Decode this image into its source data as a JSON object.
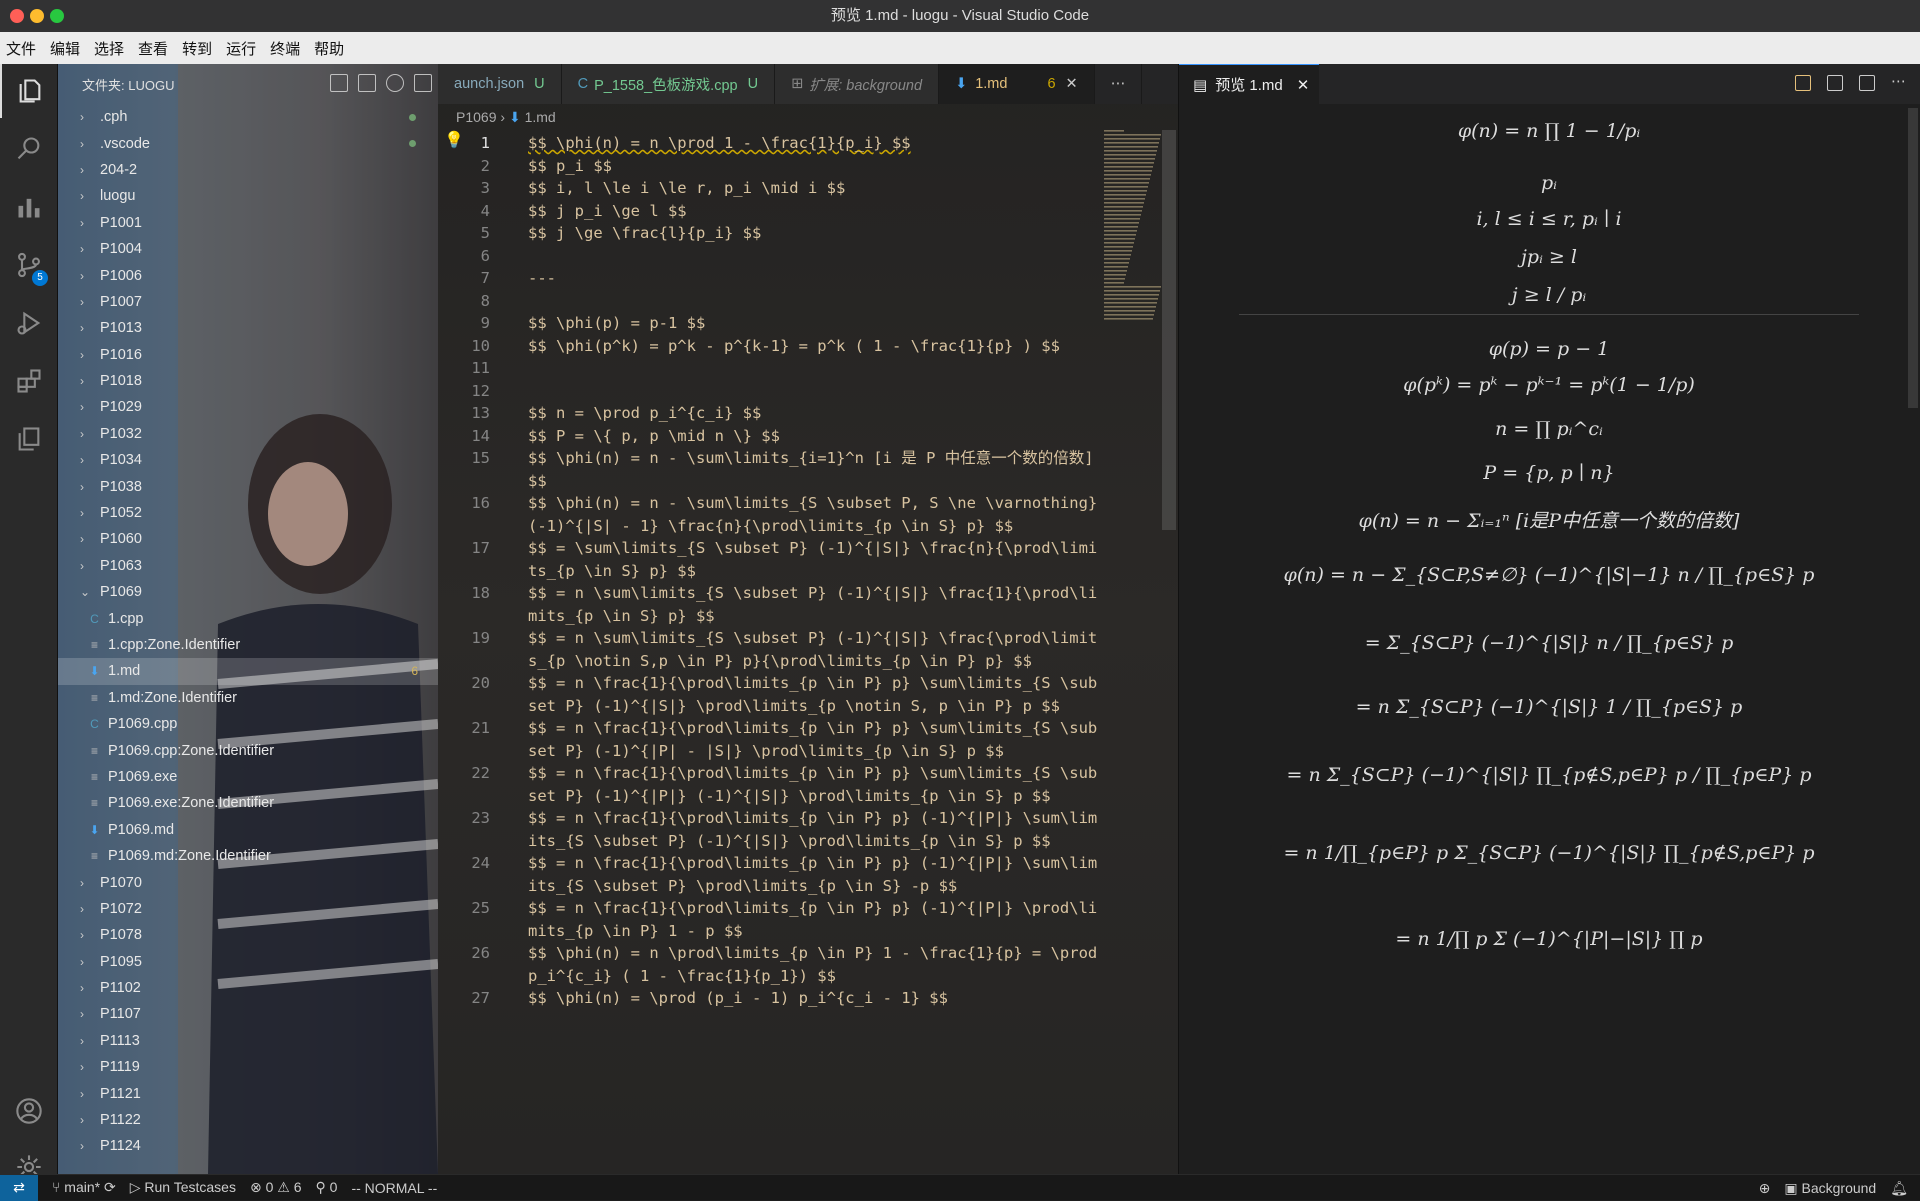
{
  "window": {
    "title": "预览 1.md - luogu - Visual Studio Code"
  },
  "menu": [
    "文件",
    "编辑",
    "选择",
    "查看",
    "转到",
    "运行",
    "终端",
    "帮助"
  ],
  "activity": {
    "scm_badge": "5"
  },
  "explorer": {
    "title": "文件夹: LUOGU",
    "items": [
      {
        "label": ".cph",
        "type": "folder",
        "marker": true
      },
      {
        "label": ".vscode",
        "type": "folder",
        "marker": true
      },
      {
        "label": "204-2",
        "type": "folder"
      },
      {
        "label": "luogu",
        "type": "folder"
      },
      {
        "label": "P1001",
        "type": "folder"
      },
      {
        "label": "P1004",
        "type": "folder"
      },
      {
        "label": "P1006",
        "type": "folder"
      },
      {
        "label": "P1007",
        "type": "folder"
      },
      {
        "label": "P1013",
        "type": "folder"
      },
      {
        "label": "P1016",
        "type": "folder"
      },
      {
        "label": "P1018",
        "type": "folder"
      },
      {
        "label": "P1029",
        "type": "folder"
      },
      {
        "label": "P1032",
        "type": "folder"
      },
      {
        "label": "P1034",
        "type": "folder"
      },
      {
        "label": "P1038",
        "type": "folder"
      },
      {
        "label": "P1052",
        "type": "folder"
      },
      {
        "label": "P1060",
        "type": "folder"
      },
      {
        "label": "P1063",
        "type": "folder"
      },
      {
        "label": "P1069",
        "type": "open"
      },
      {
        "label": "1.cpp",
        "type": "cpp"
      },
      {
        "label": "1.cpp:Zone.Identifier",
        "type": "txt"
      },
      {
        "label": "1.md",
        "type": "md",
        "selected": true,
        "badge": "6"
      },
      {
        "label": "1.md:Zone.Identifier",
        "type": "txt"
      },
      {
        "label": "P1069.cpp",
        "type": "cpp"
      },
      {
        "label": "P1069.cpp:Zone.Identifier",
        "type": "txt"
      },
      {
        "label": "P1069.exe",
        "type": "txt"
      },
      {
        "label": "P1069.exe:Zone.Identifier",
        "type": "txt"
      },
      {
        "label": "P1069.md",
        "type": "md"
      },
      {
        "label": "P1069.md:Zone.Identifier",
        "type": "txt"
      },
      {
        "label": "P1070",
        "type": "folder"
      },
      {
        "label": "P1072",
        "type": "folder"
      },
      {
        "label": "P1078",
        "type": "folder"
      },
      {
        "label": "P1095",
        "type": "folder"
      },
      {
        "label": "P1102",
        "type": "folder"
      },
      {
        "label": "P1107",
        "type": "folder"
      },
      {
        "label": "P1113",
        "type": "folder"
      },
      {
        "label": "P1119",
        "type": "folder"
      },
      {
        "label": "P1121",
        "type": "folder"
      },
      {
        "label": "P1122",
        "type": "folder"
      },
      {
        "label": "P1124",
        "type": "folder"
      }
    ]
  },
  "tabs": [
    {
      "label": "aunch.json",
      "status": "U"
    },
    {
      "label": "P_1558_色板游戏.cpp",
      "status": "U"
    },
    {
      "label": "扩展: background",
      "status": ""
    },
    {
      "label": "1.md",
      "status": "6",
      "active": true
    }
  ],
  "breadcrumb": {
    "folder": "P1069",
    "file": "1.md"
  },
  "code": [
    {
      "n": "1",
      "t": "$$ \\phi(n) = n \\prod 1 - \\frac{1}{p_i} $$"
    },
    {
      "n": "2",
      "t": "$$ p_i $$"
    },
    {
      "n": "3",
      "t": "$$ i, l \\le i \\le r, p_i \\mid i $$"
    },
    {
      "n": "4",
      "t": "$$ j p_i \\ge l $$"
    },
    {
      "n": "5",
      "t": "$$ j \\ge \\frac{l}{p_i} $$"
    },
    {
      "n": "6",
      "t": ""
    },
    {
      "n": "7",
      "t": "---"
    },
    {
      "n": "8",
      "t": ""
    },
    {
      "n": "9",
      "t": "$$ \\phi(p) = p-1 $$"
    },
    {
      "n": "10",
      "t": "$$ \\phi(p^k) = p^k - p^{k-1} = p^k ( 1 - \\frac{1}{p} ) $$"
    },
    {
      "n": "11",
      "t": ""
    },
    {
      "n": "12",
      "t": ""
    },
    {
      "n": "13",
      "t": "$$ n = \\prod p_i^{c_i} $$"
    },
    {
      "n": "14",
      "t": "$$ P = \\{ p, p \\mid n \\} $$"
    },
    {
      "n": "15",
      "t": "$$ \\phi(n) = n - \\sum\\limits_{i=1}^n [i 是 P 中任意一个数的倍数] $$"
    },
    {
      "n": "16",
      "t": "$$ \\phi(n) = n - \\sum\\limits_{S \\subset P, S \\ne \\varnothing} (-1)^{|S| - 1} \\frac{n}{\\prod\\limits_{p \\in S} p} $$"
    },
    {
      "n": "17",
      "t": "$$ = \\sum\\limits_{S \\subset P} (-1)^{|S|} \\frac{n}{\\prod\\limits_{p \\in S} p} $$"
    },
    {
      "n": "18",
      "t": "$$ = n \\sum\\limits_{S \\subset P} (-1)^{|S|} \\frac{1}{\\prod\\limits_{p \\in S} p} $$"
    },
    {
      "n": "19",
      "t": "$$ = n \\sum\\limits_{S \\subset P} (-1)^{|S|} \\frac{\\prod\\limits_{p \\notin S,p \\in P} p}{\\prod\\limits_{p \\in P} p} $$"
    },
    {
      "n": "20",
      "t": "$$ = n \\frac{1}{\\prod\\limits_{p \\in P} p} \\sum\\limits_{S \\subset P} (-1)^{|S|} \\prod\\limits_{p \\notin S, p \\in P} p $$"
    },
    {
      "n": "21",
      "t": "$$ = n \\frac{1}{\\prod\\limits_{p \\in P} p} \\sum\\limits_{S \\subset P} (-1)^{|P| - |S|} \\prod\\limits_{p \\in S} p $$"
    },
    {
      "n": "22",
      "t": "$$ = n \\frac{1}{\\prod\\limits_{p \\in P} p} \\sum\\limits_{S \\subset P} (-1)^{|P|} (-1)^{|S|} \\prod\\limits_{p \\in S} p $$"
    },
    {
      "n": "23",
      "t": "$$ = n \\frac{1}{\\prod\\limits_{p \\in P} p} (-1)^{|P|} \\sum\\limits_{S \\subset P} (-1)^{|S|} \\prod\\limits_{p \\in S} p $$"
    },
    {
      "n": "24",
      "t": "$$ = n \\frac{1}{\\prod\\limits_{p \\in P} p} (-1)^{|P|} \\sum\\limits_{S \\subset P} \\prod\\limits_{p \\in S} -p $$"
    },
    {
      "n": "25",
      "t": "$$ = n \\frac{1}{\\prod\\limits_{p \\in P} p} (-1)^{|P|} \\prod\\limits_{p \\in P} 1 - p $$"
    },
    {
      "n": "26",
      "t": "$$ \\phi(n) = n \\prod\\limits_{p \\in P} 1 - \\frac{1}{p} = \\prod p_i^{c_i} ( 1 - \\frac{1}{p_1}) $$"
    },
    {
      "n": "27",
      "t": "$$ \\phi(n) = \\prod (p_i - 1) p_i^{c_i - 1} $$"
    }
  ],
  "preview": {
    "tab": "预览 1.md",
    "eqs": [
      "φ(n) = n ∏ 1 − 1/pᵢ",
      "pᵢ",
      "i, l ≤ i ≤ r, pᵢ ∣ i",
      "jpᵢ ≥ l",
      "j ≥ l / pᵢ",
      "φ(p) = p − 1",
      "φ(pᵏ) = pᵏ − pᵏ⁻¹ = pᵏ(1 − 1/p)",
      "n = ∏ pᵢ^cᵢ",
      "P = {p, p ∣ n}",
      "φ(n) = n − Σᵢ₌₁ⁿ [i是P中任意一个数的倍数]",
      "φ(n) = n − Σ_{S⊂P,S≠∅} (−1)^{|S|−1} n / ∏_{p∈S} p",
      "= Σ_{S⊂P} (−1)^{|S|} n / ∏_{p∈S} p",
      "= n Σ_{S⊂P} (−1)^{|S|} 1 / ∏_{p∈S} p",
      "= n Σ_{S⊂P} (−1)^{|S|} ∏_{p∉S,p∈P} p / ∏_{p∈P} p",
      "= n 1/∏_{p∈P} p Σ_{S⊂P} (−1)^{|S|} ∏_{p∉S,p∈P} p",
      "= n 1/∏ p Σ (−1)^{|P|−|S|} ∏ p"
    ]
  },
  "status": {
    "branch": "main*",
    "run": "Run Testcases",
    "problems": "⊗ 0 ⚠ 6",
    "ports": "0",
    "mode": "-- NORMAL --",
    "background": "Background"
  }
}
